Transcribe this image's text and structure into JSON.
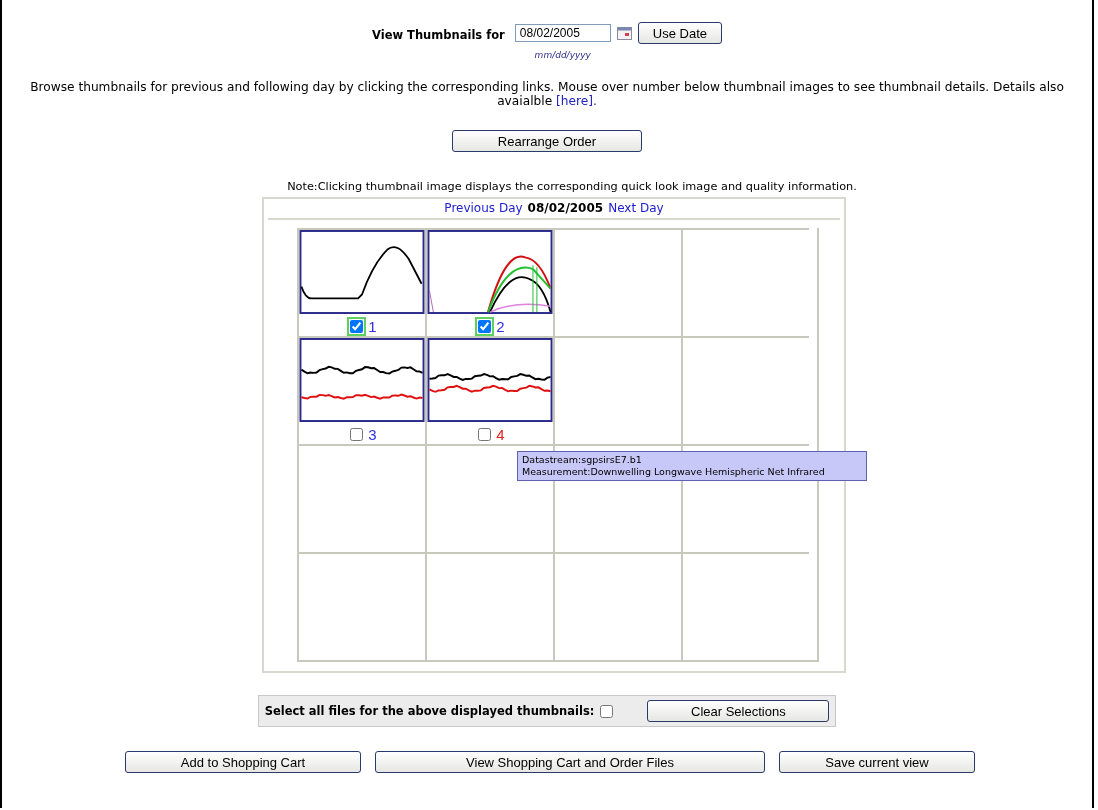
{
  "date_picker": {
    "label": "View Thumbnails for",
    "value": "08/02/2005",
    "button": "Use Date",
    "format_hint": "mm/dd/yyyy"
  },
  "instructions": {
    "text": "Browse thumbnails for previous and following day by clicking the corresponding links. Mouse over number below thumbnail images to see thumbnail details. Details also avaialble",
    "link": "[here]."
  },
  "rearrange_button": "Rearrange Order",
  "note": "Note:Clicking thumbnail image displays the corresponding quick look image and quality information.",
  "day_nav": {
    "previous": "Previous Day",
    "date": "08/02/2005",
    "next": "Next Day"
  },
  "thumbnail_rows": [
    [
      {
        "kind": "single_peak",
        "number": "1",
        "checked": true,
        "hovered": false
      },
      {
        "kind": "multi_arc",
        "number": "2",
        "checked": true,
        "hovered": false
      }
    ],
    [
      {
        "kind": "two_flat",
        "number": "3",
        "checked": false,
        "hovered": false
      },
      {
        "kind": "two_bump",
        "number": "4",
        "checked": false,
        "hovered": true
      }
    ]
  ],
  "tooltip": {
    "lines": [
      "Datastream:sgpsirsE7.b1",
      "Measurement:Downwelling Longwave Hemispheric Net Infrared"
    ]
  },
  "select_all": {
    "label": "Select all files for the above displayed thumbnails:",
    "checked": false,
    "button": "Clear Selections"
  },
  "buttons": [
    "Add to Shopping Cart",
    "View Shopping Cart and Order Files",
    "Save current view"
  ]
}
